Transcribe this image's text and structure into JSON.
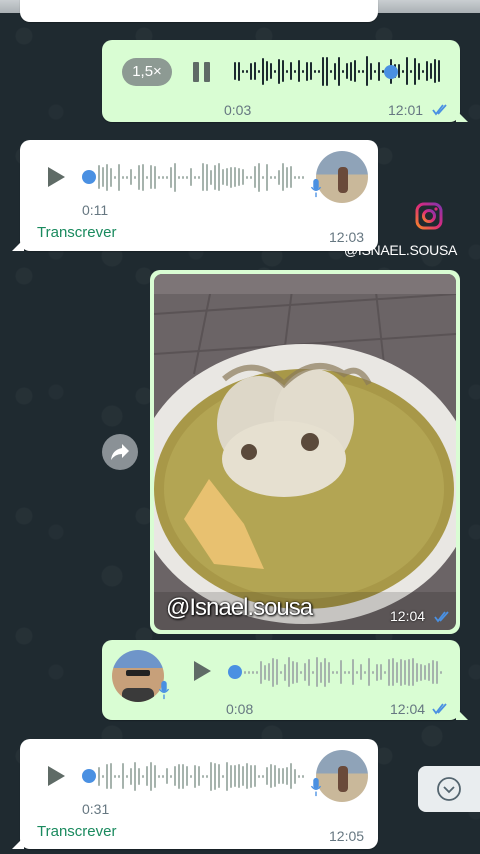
{
  "voice_out_1": {
    "speed": "1,5×",
    "duration": "0:03",
    "time": "12:01"
  },
  "voice_in_1": {
    "duration": "0:11",
    "transcribe": "Transcrever",
    "time": "12:03"
  },
  "watermark": {
    "handle": "@ISNAEL.SOUSA"
  },
  "photo_msg": {
    "caption": "@Isnael.sousa",
    "time": "12:04"
  },
  "voice_out_2": {
    "duration": "0:08",
    "time": "12:04"
  },
  "voice_in_2": {
    "duration": "0:31",
    "transcribe": "Transcrever",
    "time": "12:05"
  },
  "colors": {
    "out_bubble": "#d9fdd3",
    "in_bubble": "#ffffff",
    "accent_blue": "#4a90e2",
    "transcribe_green": "#1a8a5e",
    "wallpaper": "#1f2a30"
  },
  "icons": [
    "play-icon",
    "pause-icon",
    "mic-icon",
    "forward-icon",
    "scroll-down-icon",
    "instagram-icon",
    "read-ticks-icon"
  ]
}
